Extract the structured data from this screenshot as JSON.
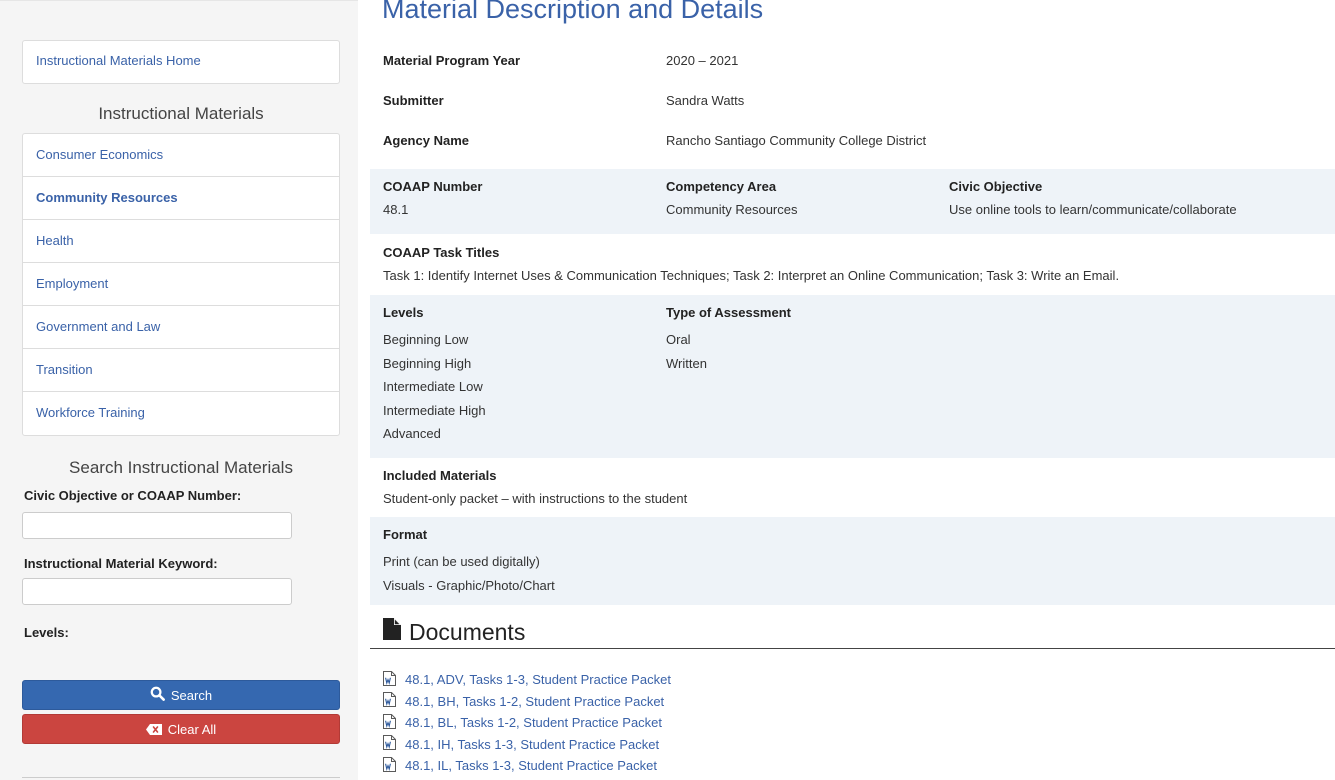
{
  "sidebar": {
    "home_link": "Instructional Materials Home",
    "materials_heading": "Instructional Materials",
    "categories": [
      {
        "label": "Consumer Economics"
      },
      {
        "label": "Community Resources"
      },
      {
        "label": "Health"
      },
      {
        "label": "Employment"
      },
      {
        "label": "Government and Law"
      },
      {
        "label": "Transition"
      },
      {
        "label": "Workforce Training"
      }
    ],
    "active_category": "Community Resources",
    "search_heading": "Search Instructional Materials",
    "civic_label": "Civic Objective or COAAP Number:",
    "civic_value": "",
    "keyword_label": "Instructional Material Keyword:",
    "keyword_value": "",
    "levels_label": "Levels:",
    "search_button": "Search",
    "clear_button": "Clear All",
    "search_icon": "search-icon",
    "clear_icon": "backspace-x-icon"
  },
  "main": {
    "title": "Material Description and Details",
    "program_year_label": "Material Program Year",
    "program_year": "2020 – 2021",
    "submitter_label": "Submitter",
    "submitter": "Sandra Watts",
    "agency_label": "Agency Name",
    "agency": "Rancho Santiago Community College District",
    "coaap_label": "COAAP Number",
    "coaap": "48.1",
    "competency_label": "Competency Area",
    "competency": "Community Resources",
    "civic_label": "Civic Objective",
    "civic": "Use online tools to learn/communicate/collaborate",
    "task_titles_label": "COAAP Task Titles",
    "task_titles": "Task 1: Identify Internet Uses & Communication Techniques; Task 2: Interpret an Online Communication; Task 3: Write an Email.",
    "levels_label": "Levels",
    "levels": [
      "Beginning Low",
      "Beginning High",
      "Intermediate Low",
      "Intermediate High",
      "Advanced"
    ],
    "assessment_label": "Type of Assessment",
    "assessments": [
      "Oral",
      "Written"
    ],
    "included_label": "Included Materials",
    "included": "Student-only packet – with instructions to the student",
    "format_label": "Format",
    "formats": [
      "Print (can be used digitally)",
      "Visuals - Graphic/Photo/Chart"
    ],
    "documents_heading": "Documents",
    "documents_icon": "file-icon",
    "documents": [
      {
        "title": "48.1, ADV, Tasks 1-3, Student Practice Packet",
        "icon": "word-file-icon"
      },
      {
        "title": "48.1, BH, Tasks 1-2, Student Practice Packet",
        "icon": "word-file-icon"
      },
      {
        "title": "48.1, BL, Tasks 1-2, Student Practice Packet",
        "icon": "word-file-icon"
      },
      {
        "title": "48.1, IH, Tasks 1-3, Student Practice Packet",
        "icon": "word-file-icon"
      },
      {
        "title": "48.1, IL, Tasks 1-3, Student Practice Packet",
        "icon": "word-file-icon"
      }
    ]
  },
  "colors": {
    "link": "#3a62a8",
    "search_button": "#3568b0",
    "clear_button": "#cb4540",
    "shaded_row": "#eef3f8",
    "sidebar_bg": "#f5f5f5"
  }
}
